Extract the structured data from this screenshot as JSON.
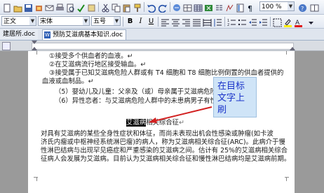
{
  "toolbar": {
    "zoom_value": "100 %",
    "style_value": "正文",
    "font_value": "宋体",
    "size_value": "五号",
    "bold_label": "B",
    "italic_label": "I",
    "underline_label": "U"
  },
  "tabs": {
    "left_label": "建居所.doc",
    "active_label": "预防艾滋病基本知识.doc"
  },
  "document": {
    "lines": [
      "①接受多个供血者的血液。↵",
      "②在艾滋病流行地区接受输血。↵",
      "③接受属于已知艾滋病危险人群或有 T4 细胞和 T8 细胞比例倒置的供血者提供的",
      "血液或血制品。↵",
      "（5）婴幼儿及儿童：父亲及（或）母亲属于艾滋病危险",
      "（6）异性恋者：与艾滋病危险人群中的未患病男子有性",
      "对具有艾滋病的某些全身性症状和体征，而尚未表现出机会性感染或肿瘤(如卡波",
      "济氏内瘤或中枢神经系统淋巴瘤)的病人，称为艾滋病相关综合征(ARC)。此病介于慢",
      "性淋巴结病与出现罕见癌症和严重感染的艾滋病之间。估计有 25%的艾滋病相关综合",
      "征病人会发展为艾滋病。目前认为艾滋病相关综合征和慢性淋巴结病均是艾滋病前期。"
    ],
    "heading_selected": "艾滋病",
    "heading_rest": "相关综合征",
    "callout_text": "在目标文字上刷",
    "para_mark": "↵"
  },
  "colors": {
    "callout_bg": "#cfe4f7",
    "callout_text": "#1a33c9",
    "arrow": "#d22020",
    "selection": "#000000"
  }
}
